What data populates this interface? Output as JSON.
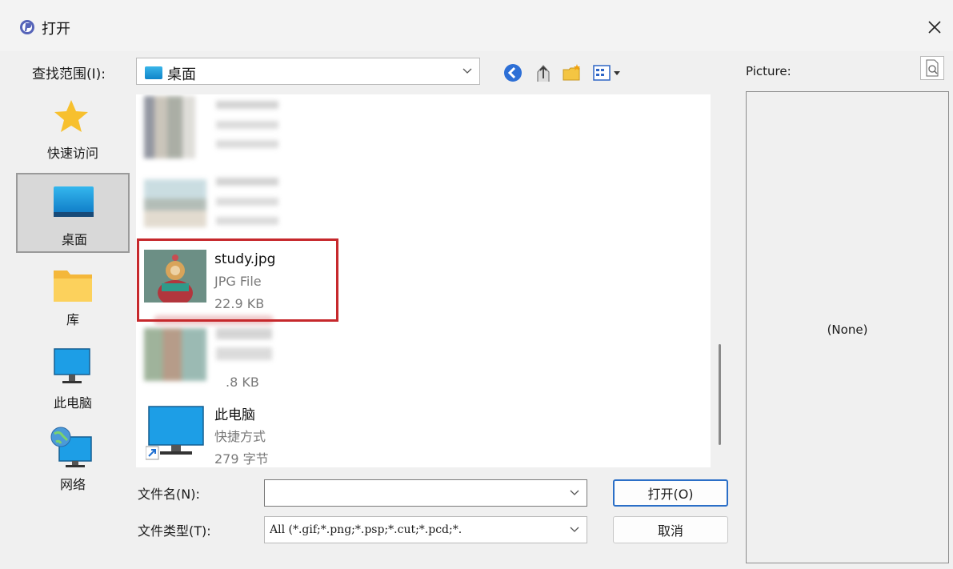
{
  "window": {
    "title": "打开",
    "close_glyph": "×"
  },
  "look_in": {
    "label": "查找范围(I):",
    "value": "桌面"
  },
  "places": [
    {
      "label": "快速访问"
    },
    {
      "label": "桌面"
    },
    {
      "label": "库"
    },
    {
      "label": "此电脑"
    },
    {
      "label": "网络"
    }
  ],
  "files": [
    {
      "name": "",
      "type": "",
      "size": ""
    },
    {
      "name": "",
      "type": "",
      "size": ""
    },
    {
      "name": "study.jpg",
      "type": "JPG File",
      "size": "22.9 KB"
    },
    {
      "name": "",
      "type": "",
      "size": ".8 KB"
    },
    {
      "name": "此电脑",
      "type": "快捷方式",
      "size": "279 字节"
    }
  ],
  "file_name": {
    "label": "文件名(N):",
    "value": ""
  },
  "file_type": {
    "label": "文件类型(T):",
    "value": "All (*.gif;*.png;*.psp;*.cut;*.pcd;*."
  },
  "buttons": {
    "open": "打开(O)",
    "cancel": "取消"
  },
  "preview": {
    "label": "Picture:",
    "none_text": "(None)"
  },
  "colors": {
    "accent": "#2b6fc7",
    "highlight": "#c6282c",
    "folder": "#f7c341",
    "desktop": "#1f9ce0"
  }
}
